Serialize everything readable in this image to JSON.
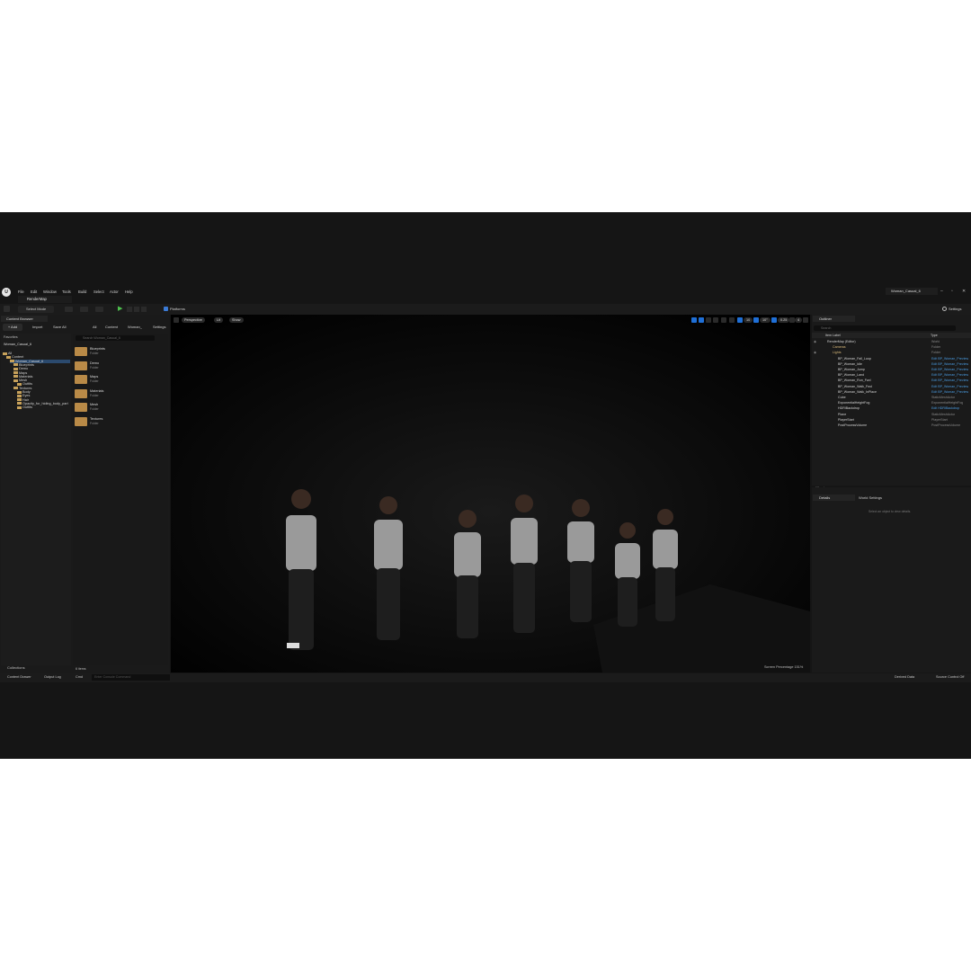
{
  "window": {
    "project_tab": "Woman_Casual_6",
    "menu": [
      "File",
      "Edit",
      "Window",
      "Tools",
      "Build",
      "Select",
      "Actor",
      "Help"
    ],
    "map_tab": "RenderMap",
    "controls": [
      "–",
      "▫",
      "✕"
    ]
  },
  "toolbar": {
    "select_mode": "Select Mode",
    "platforms": "Platforms",
    "settings": "Settings"
  },
  "content_browser": {
    "tab": "Content Browser",
    "add": "+ Add",
    "import": "Import",
    "save_all": "Save All",
    "path": [
      "All",
      "Content",
      "Woman_"
    ],
    "settings": "Settings",
    "favorites": "Favorites",
    "root": "Woman_Casual_6",
    "tree": [
      {
        "label": "All",
        "depth": 0
      },
      {
        "label": "Content",
        "depth": 1
      },
      {
        "label": "Woman_Casual_6",
        "depth": 2,
        "selected": true
      },
      {
        "label": "Blueprints",
        "depth": 3
      },
      {
        "label": "Demo",
        "depth": 3
      },
      {
        "label": "Maps",
        "depth": 3
      },
      {
        "label": "Materials",
        "depth": 3
      },
      {
        "label": "Mesh",
        "depth": 3
      },
      {
        "label": "Outfits",
        "depth": 4
      },
      {
        "label": "Textures",
        "depth": 3
      },
      {
        "label": "Body",
        "depth": 4
      },
      {
        "label": "Eyes",
        "depth": 4
      },
      {
        "label": "Hair",
        "depth": 4
      },
      {
        "label": "Opacity_for_hiding_body_part",
        "depth": 4
      },
      {
        "label": "Outfits",
        "depth": 4
      }
    ],
    "search_placeholder": "Search Woman_Casual_6",
    "folders": [
      {
        "name": "Blueprints",
        "type": "Folder"
      },
      {
        "name": "Demo",
        "type": "Folder"
      },
      {
        "name": "Maps",
        "type": "Folder"
      },
      {
        "name": "Materials",
        "type": "Folder"
      },
      {
        "name": "Mesh",
        "type": "Folder"
      },
      {
        "name": "Textures",
        "type": "Folder"
      }
    ],
    "collections": "Collections",
    "items_count": "6 items"
  },
  "viewport": {
    "perspective": "Perspective",
    "lit": "Lit",
    "show": "Show",
    "grid_snap": "10",
    "rot_snap": "10°",
    "scale_snap": "0.25",
    "camera_speed": "4",
    "screen_percentage": "Screen Percentage  151%"
  },
  "outliner": {
    "tab": "Outliner",
    "search_placeholder": "Search",
    "col_label": "Item Label",
    "col_type": "Type",
    "rows": [
      {
        "name": "RenderMap (Editor)",
        "type": "World",
        "depth": 0
      },
      {
        "name": "Cameras",
        "type": "Folder",
        "depth": 1,
        "folder": true
      },
      {
        "name": "Lights",
        "type": "Folder",
        "depth": 1,
        "folder": true
      },
      {
        "name": "BP_Woman_Fall_Loop",
        "type": "Edit BP_Woman_Preview",
        "depth": 2,
        "link": true
      },
      {
        "name": "BP_Woman_Idle",
        "type": "Edit BP_Woman_Preview",
        "depth": 2,
        "link": true
      },
      {
        "name": "BP_Woman_Jump",
        "type": "Edit BP_Woman_Preview",
        "depth": 2,
        "link": true
      },
      {
        "name": "BP_Woman_Land",
        "type": "Edit BP_Woman_Preview",
        "depth": 2,
        "link": true
      },
      {
        "name": "BP_Woman_Run_Fwd",
        "type": "Edit BP_Woman_Preview",
        "depth": 2,
        "link": true
      },
      {
        "name": "BP_Woman_Walk_Fwd",
        "type": "Edit BP_Woman_Preview",
        "depth": 2,
        "link": true
      },
      {
        "name": "BP_Woman_Walk_InPlace",
        "type": "Edit BP_Woman_Preview",
        "depth": 2,
        "link": true
      },
      {
        "name": "Cube",
        "type": "StaticMeshActor",
        "depth": 2
      },
      {
        "name": "ExponentialHeightFog",
        "type": "ExponentialHeightFog",
        "depth": 2
      },
      {
        "name": "HDRIBackdrop",
        "type": "Edit HDRIBackdrop",
        "depth": 2,
        "link": true
      },
      {
        "name": "Plane",
        "type": "StaticMeshActor",
        "depth": 2
      },
      {
        "name": "PlayerStart",
        "type": "PlayerStart",
        "depth": 2
      },
      {
        "name": "PostProcessVolume",
        "type": "PostProcessVolume",
        "depth": 2
      }
    ],
    "actors_count": "16 actors"
  },
  "details": {
    "tab": "Details",
    "world_settings": "World Settings",
    "empty_hint": "Select an object to view details."
  },
  "bottom": {
    "content_drawer": "Content Drawer",
    "output_log": "Output Log",
    "cmd": "Cmd",
    "cmd_placeholder": "Enter Console Command",
    "derived_data": "Derived Data",
    "source_control": "Source Control Off"
  }
}
